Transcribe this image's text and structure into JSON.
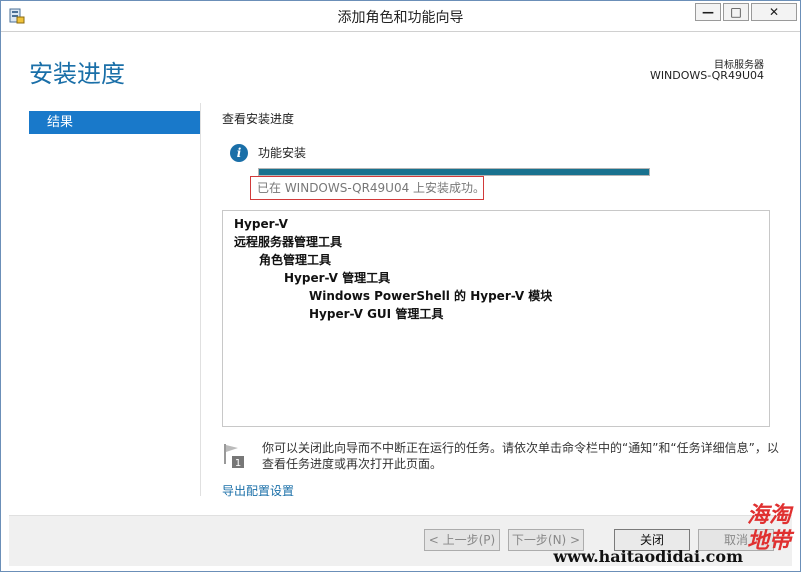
{
  "window": {
    "title": "添加角色和功能向导",
    "min_label": "—",
    "max_label": "□",
    "close_label": "✕"
  },
  "header": {
    "page_title": "安装进度",
    "destination_label": "目标服务器",
    "destination_server": "WINDOWS-QR49U04"
  },
  "nav": {
    "items": [
      {
        "label": "结果",
        "selected": true
      }
    ]
  },
  "main": {
    "section_title": "查看安装进度",
    "feature_title": "功能安装",
    "progress_fraction": 1.0,
    "status_text": "已在 WINDOWS-QR49U04 上安装成功。",
    "results": [
      {
        "text": "Hyper-V",
        "level": 0
      },
      {
        "text": "远程服务器管理工具",
        "level": 0
      },
      {
        "text": "角色管理工具",
        "level": 1
      },
      {
        "text": "Hyper-V 管理工具",
        "level": 2
      },
      {
        "text": "Windows PowerShell 的 Hyper-V 模块",
        "level": 3
      },
      {
        "text": "Hyper-V GUI 管理工具",
        "level": 3
      }
    ],
    "note_badge": "1",
    "note_text": "你可以关闭此向导而不中断正在运行的任务。请依次单击命令栏中的“通知”和“任务详细信息”，以查看任务进度或再次打开此页面。",
    "export_link": "导出配置设置"
  },
  "footer": {
    "prev_label": "< 上一步(P)",
    "next_label": "下一步(N) >",
    "close_label": "关闭",
    "cancel_label": "取消"
  },
  "watermark": {
    "cn_line1": "海淘",
    "cn_line2": "地带",
    "url": "www.haitaodidai.com"
  },
  "colors": {
    "accent": "#1a6fa8",
    "nav_selected": "#1979ca",
    "progress": "#19728f",
    "status_border": "#d13a3a"
  }
}
